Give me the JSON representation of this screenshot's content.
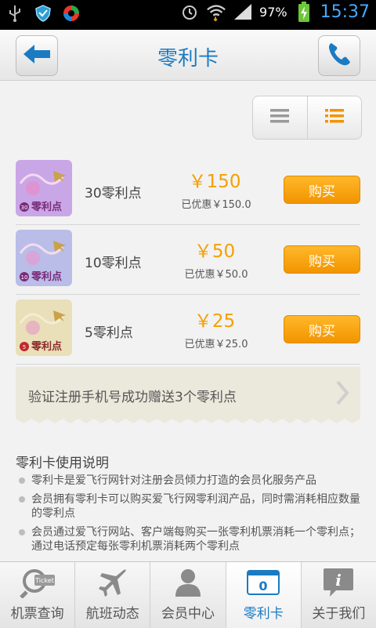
{
  "status_bar": {
    "battery_percent": "97%",
    "time": "15:37",
    "icons": [
      "usb-icon",
      "shield-icon",
      "app-icon",
      "alarm-icon",
      "wifi-icon",
      "signal-icon",
      "battery-icon"
    ]
  },
  "header": {
    "title": "零利卡",
    "back_icon": "back-arrow-icon",
    "phone_icon": "phone-icon"
  },
  "view_toggle": {
    "options": [
      "list-plain-icon",
      "list-detail-icon"
    ],
    "selected": "list-detail-icon"
  },
  "cards": [
    {
      "name": "30零利点",
      "price": "￥150",
      "saved": "已优惠￥150.0",
      "buy_label": "购买",
      "badge_number": "30",
      "badge_text": "零利点",
      "thumb_color": "#c9a7e6"
    },
    {
      "name": "10零利点",
      "price": "￥50",
      "saved": "已优惠￥50.0",
      "buy_label": "购买",
      "badge_number": "10",
      "badge_text": "零利点",
      "thumb_color": "#b9bde8"
    },
    {
      "name": "5零利点",
      "price": "￥25",
      "saved": "已优惠￥25.0",
      "buy_label": "购买",
      "badge_number": "5",
      "badge_text": "零利点",
      "thumb_color": "#e9dfb8"
    }
  ],
  "promo": {
    "text": "验证注册手机号成功赠送3个零利点"
  },
  "description": {
    "title": "零利卡使用说明",
    "items": [
      "零利卡是爱飞行网针对注册会员倾力打造的会员化服务产品",
      "会员拥有零利卡可以购买爱飞行网零利润产品，同时需消耗相应数量的零利点",
      "会员通过爱飞行网站、客户端每购买一张零利机票消耗一个零利点；通过电话预定每张零利机票消耗两个零利点"
    ]
  },
  "tabs": [
    {
      "label": "机票查询",
      "icon": "ticket-search-icon",
      "icon_text": "Ticket"
    },
    {
      "label": "航班动态",
      "icon": "plane-icon"
    },
    {
      "label": "会员中心",
      "icon": "person-icon"
    },
    {
      "label": "零利卡",
      "icon": "card-icon",
      "icon_text": "0",
      "active": true
    },
    {
      "label": "关于我们",
      "icon": "info-icon",
      "icon_text": "i"
    }
  ],
  "colors": {
    "accent": "#1b7bc2",
    "price": "#f5a000",
    "buy_button": "#f7a100",
    "time": "#44aaff"
  }
}
